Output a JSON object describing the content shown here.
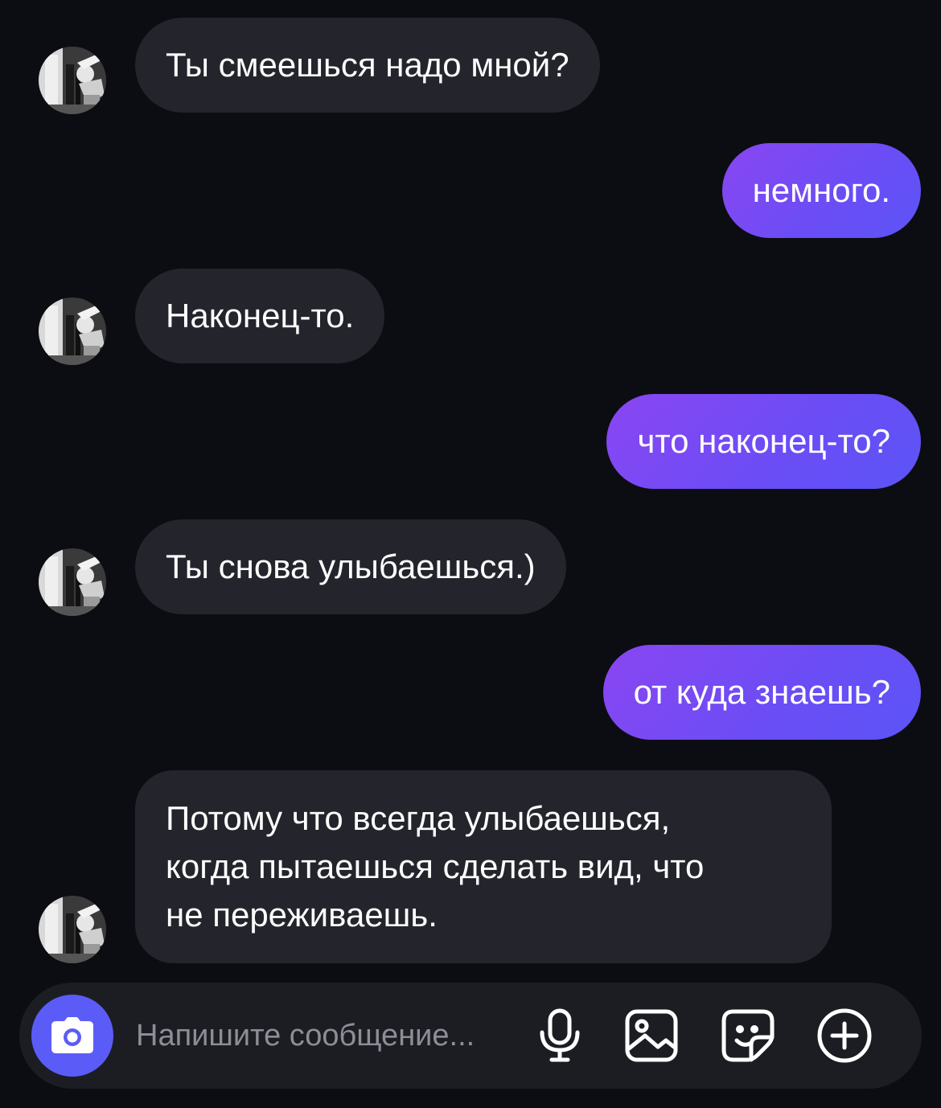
{
  "messages": [
    {
      "direction": "in",
      "text": "Ты смеешься надо мной?"
    },
    {
      "direction": "out",
      "text": "немного."
    },
    {
      "direction": "in",
      "text": "Наконец-то."
    },
    {
      "direction": "out",
      "text": "что наконец-то?"
    },
    {
      "direction": "in",
      "text": "Ты снова улыбаешься.)"
    },
    {
      "direction": "out",
      "text": "от куда знаешь?"
    },
    {
      "direction": "in",
      "lines": [
        "Потому что всегда улыбаешься,",
        "когда пытаешься сделать вид, что",
        "не переживаешь."
      ]
    }
  ],
  "composer": {
    "placeholder": "Напишите сообщение...",
    "icons": [
      "camera-icon",
      "microphone-icon",
      "image-icon",
      "sticker-icon",
      "plus-icon"
    ]
  },
  "colors": {
    "background": "#0c0d12",
    "incoming_bubble": "#24252c",
    "outgoing_bubble_start": "#8a46f2",
    "outgoing_bubble_end": "#5b55f7",
    "accent": "#5b5cf7",
    "composer_bg": "#1c1d23",
    "placeholder": "#8c8e97"
  }
}
